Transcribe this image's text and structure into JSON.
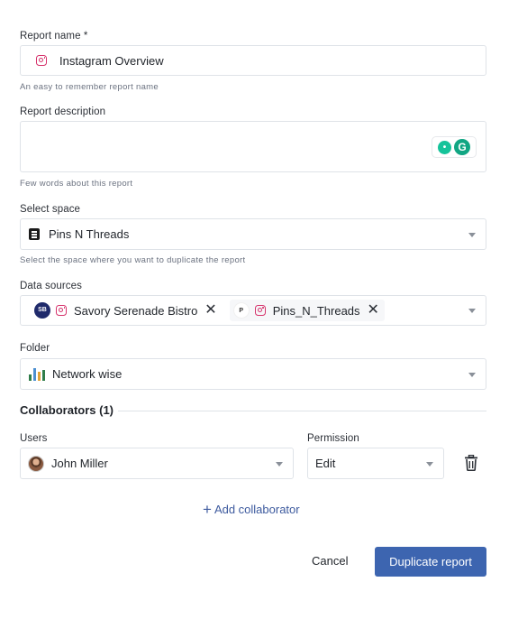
{
  "report_name": {
    "label": "Report name *",
    "value": "Instagram Overview",
    "hint": "An easy to remember report name"
  },
  "report_description": {
    "label": "Report description",
    "value": "",
    "hint": "Few words about this report",
    "grammarly_letter": "G",
    "bulb_glyph": "•"
  },
  "select_space": {
    "label": "Select space",
    "value": "Pins N Threads",
    "hint": "Select the space where you want to duplicate the report"
  },
  "data_sources": {
    "label": "Data sources",
    "chips": [
      {
        "avatar": "SB",
        "name": "Savory Serenade Bistro",
        "remove": "✕"
      },
      {
        "avatar": "P",
        "name": "Pins_N_Threads",
        "remove": "✕"
      }
    ]
  },
  "folder": {
    "label": "Folder",
    "value": "Network wise",
    "icon_colors": [
      "#2f7d4a",
      "#4c8fd1",
      "#e0a33a",
      "#2f7d4a"
    ]
  },
  "collaborators": {
    "title": "Collaborators (1)",
    "users_label": "Users",
    "permission_label": "Permission",
    "user": "John Miller",
    "permission": "Edit",
    "add_label": "Add collaborator",
    "add_glyph": "+"
  },
  "actions": {
    "cancel": "Cancel",
    "primary": "Duplicate report"
  },
  "colors": {
    "accent": "#3d65b0",
    "link": "#3d5a9e",
    "instagram": "#d6336c",
    "grammarly": "#11a683"
  }
}
